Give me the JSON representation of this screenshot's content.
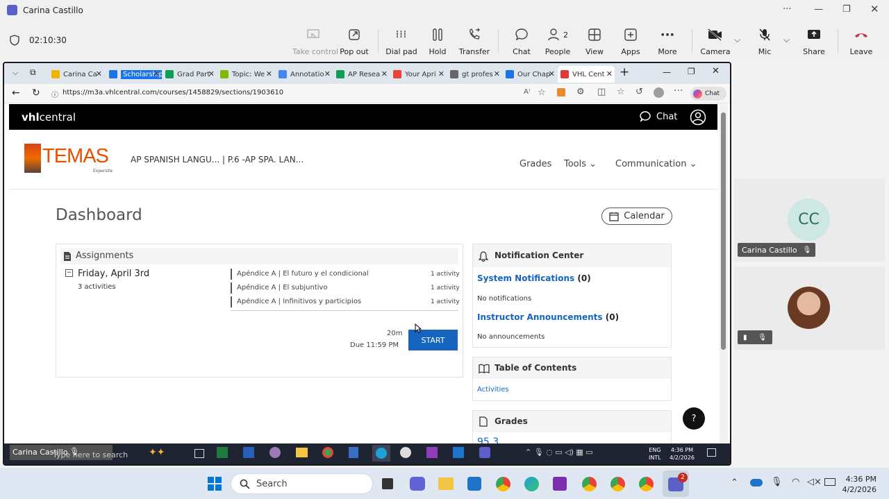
{
  "teams": {
    "title": "Carina Castillo",
    "timer": "02:10:30",
    "buttons": {
      "take_control": "Take control",
      "pop_out": "Pop out",
      "dial_pad": "Dial pad",
      "hold": "Hold",
      "transfer": "Transfer",
      "chat": "Chat",
      "people": "People",
      "people_count": "2",
      "view": "View",
      "apps": "Apps",
      "more": "More",
      "camera": "Camera",
      "mic": "Mic",
      "share": "Share",
      "leave": "Leave"
    },
    "participants": [
      {
        "initials": "CC",
        "name": "Carina Castillo"
      }
    ]
  },
  "browser": {
    "tabs": [
      {
        "label": "Carina Ca",
        "color": "#f0b400"
      },
      {
        "label": "Scholarships ar",
        "color": "#1a73e8",
        "highlight": true
      },
      {
        "label": "Grad Part",
        "color": "#0f9d58"
      },
      {
        "label": "Topic: We",
        "color": "#7fba00"
      },
      {
        "label": "Annotatio",
        "color": "#4285f4"
      },
      {
        "label": "AP Resea",
        "color": "#0f9d58"
      },
      {
        "label": "Your Apri",
        "color": "#ea4335"
      },
      {
        "label": "gt profes",
        "color": "#666666"
      },
      {
        "label": "Our Chap",
        "color": "#1a73e8"
      },
      {
        "label": "VHL Cent",
        "color": "#e53935",
        "active": true
      }
    ],
    "url": "https://m3a.vhlcentral.com/courses/1458829/sections/1903610",
    "copilot_label": "Chat"
  },
  "vhl": {
    "brand_bold": "vhl",
    "brand_light": "central",
    "chat_label": "Chat",
    "logo_text": "TEMAS",
    "logo_sub": "Expersite",
    "course": "AP SPANISH LANGU... | P.6 -AP SPA. LAN...",
    "nav": {
      "grades": "Grades",
      "tools": "Tools",
      "communication": "Communication"
    },
    "dashboard_title": "Dashboard",
    "calendar_label": "Calendar",
    "assignments": {
      "heading": "Assignments",
      "date": "Friday, April 3rd",
      "count": "3 activities",
      "items": [
        {
          "title": "Apéndice A | El futuro y el condicional",
          "meta": "1 activity"
        },
        {
          "title": "Apéndice A | El subjuntivo",
          "meta": "1 activity"
        },
        {
          "title": "Apéndice A | Infinitivos y participios",
          "meta": "1 activity"
        }
      ],
      "time": "20m",
      "due": "Due 11:59 PM",
      "start_label": "START"
    },
    "notifications": {
      "heading": "Notification Center",
      "system_label": "System Notifications",
      "system_count": "(0)",
      "system_empty": "No notifications",
      "instructor_label": "Instructor Announcements",
      "instructor_count": "(0)",
      "instructor_empty": "No announcements"
    },
    "toc": {
      "heading": "Table of Contents",
      "link": "Activities"
    },
    "grades": {
      "heading": "Grades",
      "value": "95.3"
    }
  },
  "inner_taskbar": {
    "sharer": "Carina Castillo",
    "search_placeholder": "Type here to search",
    "lang": "ENG",
    "lang2": "INTL",
    "time": "4:36 PM",
    "date": "4/2/2026"
  },
  "taskbar": {
    "search_placeholder": "Search",
    "time": "4:36 PM",
    "date": "4/2/2026",
    "teams_badge": "2"
  }
}
